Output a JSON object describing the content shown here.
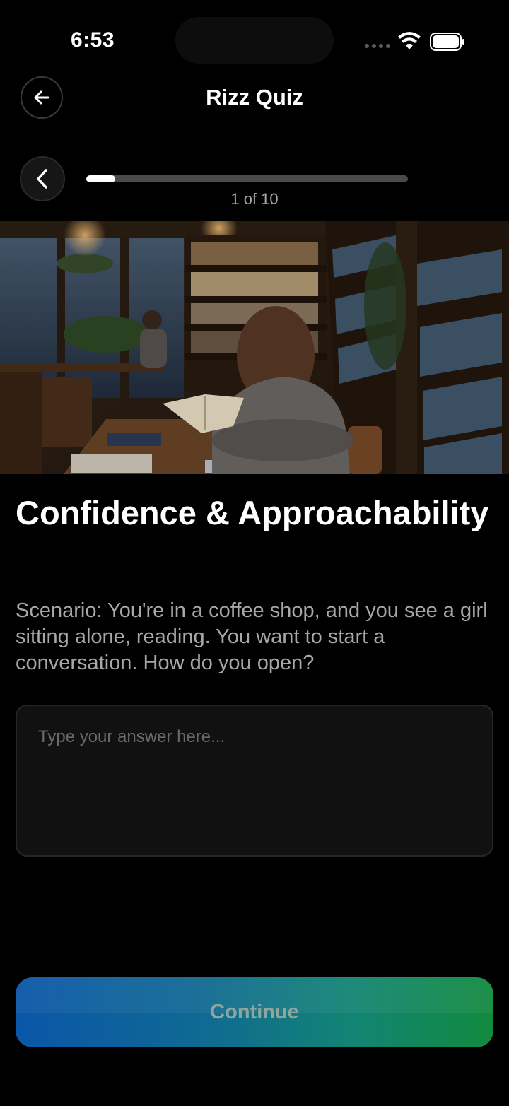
{
  "status_bar": {
    "time": "6:53"
  },
  "header": {
    "title": "Rizz Quiz",
    "back_icon": "arrow-left-icon"
  },
  "progress": {
    "current": 1,
    "total": 10,
    "fraction": 0.09,
    "label": "1 of 10",
    "back_icon": "chevron-left-icon"
  },
  "question": {
    "title": "Confidence & Approachability",
    "text": "Scenario: You're in a coffee shop, and you see a girl sitting alone, reading. You want to start a conversation. How do you open?"
  },
  "answer": {
    "placeholder": "Type your answer here...",
    "value": ""
  },
  "continue_button": {
    "label": "Continue"
  },
  "colors": {
    "background": "#000000",
    "gradient_start": "#0a56a8",
    "gradient_end": "#128a3e"
  }
}
